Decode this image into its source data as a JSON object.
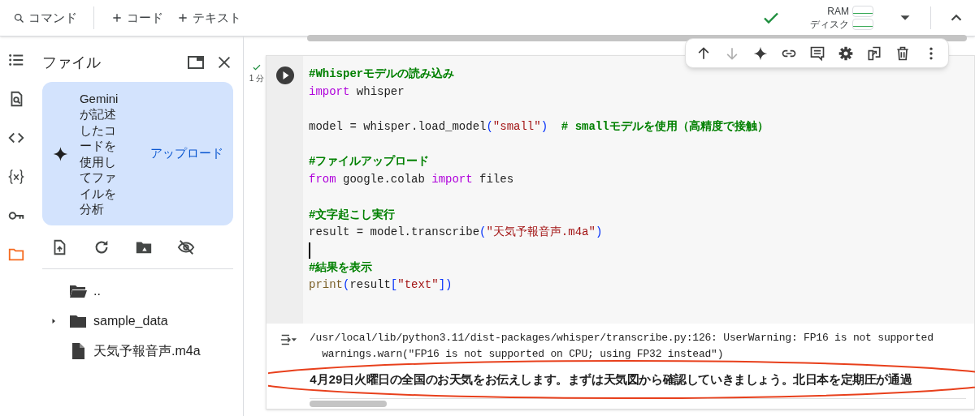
{
  "toolbar": {
    "items": [
      {
        "kind": "search",
        "label": "コマンド"
      },
      {
        "kind": "add",
        "label": "コード"
      },
      {
        "kind": "add",
        "label": "テキスト"
      }
    ],
    "status": {
      "connected": true,
      "ram_label": "RAM",
      "disk_label": "ディスク"
    }
  },
  "rail": [
    {
      "selected": false
    },
    {
      "selected": false
    },
    {
      "selected": false
    },
    {
      "selected": false
    },
    {
      "selected": false
    },
    {
      "selected": true
    }
  ],
  "sidebar": {
    "title": "ファイル",
    "gemini_card": {
      "text": "Geminiが記述したコードを使用してファイルを分析",
      "action": "アップロード"
    },
    "tree": [
      {
        "kind": "parent",
        "name": ".."
      },
      {
        "kind": "folder",
        "name": "sample_data",
        "expanded": false
      },
      {
        "kind": "file",
        "name": "天気予報音声.m4a"
      }
    ]
  },
  "cell_toolbar": [
    {
      "disabled": false
    },
    {
      "disabled": true
    },
    {
      "disabled": false
    },
    {
      "disabled": false
    },
    {
      "disabled": false
    },
    {
      "disabled": false
    },
    {
      "disabled": false
    },
    {
      "disabled": false
    },
    {
      "disabled": false
    }
  ],
  "cell": {
    "executed": true,
    "elapsed": "1 分",
    "code": [
      {
        "kind": "code",
        "tokens": [
          {
            "kind": "comment",
            "text": "#Whisperモデルの読み込み"
          }
        ]
      },
      {
        "kind": "code",
        "tokens": [
          {
            "kind": "keyword",
            "text": "import"
          },
          {
            "kind": "plain",
            "text": " whisper"
          }
        ]
      },
      {
        "kind": "blank"
      },
      {
        "kind": "code",
        "tokens": [
          {
            "kind": "plain",
            "text": "model = whisper.load_model"
          },
          {
            "kind": "paren",
            "text": "("
          },
          {
            "kind": "string",
            "text": "\"small\""
          },
          {
            "kind": "paren",
            "text": ")"
          },
          {
            "kind": "comment",
            "text": "  # smallモデルを使用（高精度で接触）"
          }
        ]
      },
      {
        "kind": "blank"
      },
      {
        "kind": "code",
        "tokens": [
          {
            "kind": "comment",
            "text": "#ファイルアップロード"
          }
        ]
      },
      {
        "kind": "code",
        "tokens": [
          {
            "kind": "keyword",
            "text": "from"
          },
          {
            "kind": "plain",
            "text": " google.colab "
          },
          {
            "kind": "keyword",
            "text": "import"
          },
          {
            "kind": "plain",
            "text": " files"
          }
        ]
      },
      {
        "kind": "blank"
      },
      {
        "kind": "code",
        "tokens": [
          {
            "kind": "comment",
            "text": "#文字起こし実行"
          }
        ]
      },
      {
        "kind": "code",
        "tokens": [
          {
            "kind": "plain",
            "text": "result = model.transcribe"
          },
          {
            "kind": "paren",
            "text": "("
          },
          {
            "kind": "string",
            "text": "\"天気予報音声.m4a\""
          },
          {
            "kind": "paren",
            "text": ")"
          }
        ]
      },
      {
        "kind": "cursor"
      },
      {
        "kind": "code",
        "tokens": [
          {
            "kind": "comment",
            "text": "#結果を表示"
          }
        ]
      },
      {
        "kind": "code",
        "tokens": [
          {
            "kind": "builtin",
            "text": "print"
          },
          {
            "kind": "paren",
            "text": "("
          },
          {
            "kind": "plain",
            "text": "result"
          },
          {
            "kind": "paren",
            "text": "["
          },
          {
            "kind": "string",
            "text": "\"text\""
          },
          {
            "kind": "paren",
            "text": "])"
          }
        ]
      }
    ],
    "output": [
      {
        "kind": "stderr",
        "text": "/usr/local/lib/python3.11/dist-packages/whisper/transcribe.py:126: UserWarning: FP16 is not supported"
      },
      {
        "kind": "stderr",
        "text": "  warnings.warn(\"FP16 is not supported on CPU; using FP32 instead\")"
      },
      {
        "kind": "stdout",
        "text": "4月29日火曜日の全国のお天気をお伝えします。まずは天気図から確認していきましょう。北日本を定期圧が通過"
      }
    ]
  }
}
